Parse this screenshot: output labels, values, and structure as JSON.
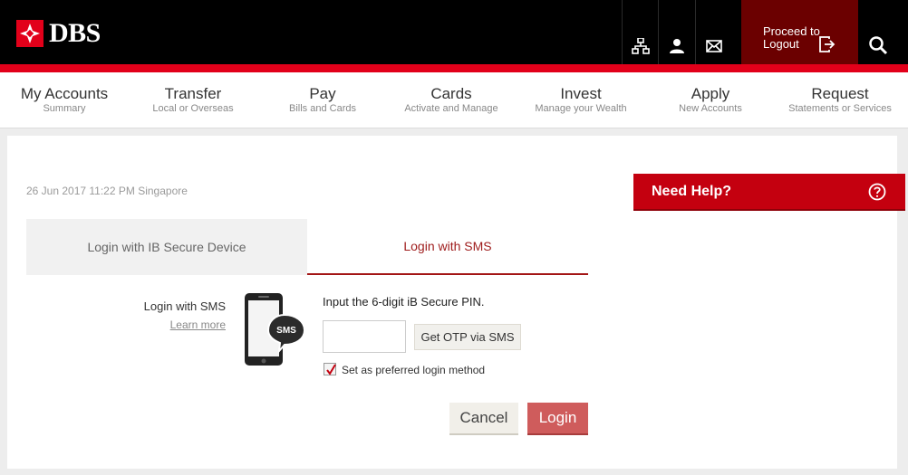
{
  "brand": {
    "name": "DBS"
  },
  "header": {
    "icons": [
      "sitemap-icon",
      "user-icon",
      "mail-icon"
    ],
    "logout_label_line1": "Proceed to",
    "logout_label_line2": "Logout",
    "search_icon": "search-icon"
  },
  "nav": {
    "items": [
      {
        "label": "My Accounts",
        "sub": "Summary"
      },
      {
        "label": "Transfer",
        "sub": "Local or Overseas"
      },
      {
        "label": "Pay",
        "sub": "Bills and Cards"
      },
      {
        "label": "Cards",
        "sub": "Activate and Manage"
      },
      {
        "label": "Invest",
        "sub": "Manage your Wealth"
      },
      {
        "label": "Apply",
        "sub": "New Accounts"
      },
      {
        "label": "Request",
        "sub": "Statements or Services"
      }
    ]
  },
  "main": {
    "datetime": "26 Jun 2017 11:22 PM Singapore",
    "tabs": [
      {
        "label": "Login with IB Secure Device",
        "active": false
      },
      {
        "label": "Login with SMS",
        "active": true
      }
    ],
    "sms_label": "Login with SMS",
    "learn_more": "Learn more",
    "phone_badge": "SMS",
    "pin_prompt": "Input the 6-digit iB Secure PIN.",
    "otp_input_value": "",
    "otp_button": "Get OTP via SMS",
    "preferred_label": "Set as preferred login method",
    "preferred_checked": true,
    "cancel_button": "Cancel",
    "login_button": "Login"
  },
  "help": {
    "title": "Need Help?"
  },
  "colors": {
    "brand_red": "#e2001a",
    "logout_bg": "#6b0000",
    "tab_active": "#a31515",
    "login_btn": "#cf5c5c",
    "help_bg": "#c4000f"
  }
}
